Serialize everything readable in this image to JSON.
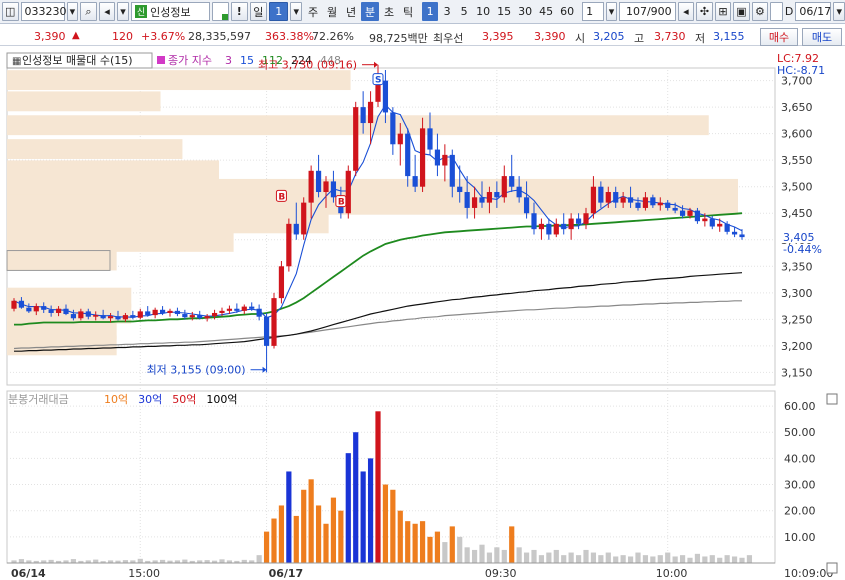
{
  "toolbar": {
    "code": "033230",
    "badge": "신",
    "stock_name": "인성정보",
    "exclaim": "!",
    "period_main": "일",
    "period_main_num": "1",
    "periods": [
      "주",
      "월",
      "년",
      "분",
      "초",
      "틱"
    ],
    "period_selected": "분",
    "intervals": [
      "1",
      "3",
      "5",
      "10",
      "15",
      "30",
      "45",
      "60"
    ],
    "interval_selected": "1",
    "interval_custom": "1",
    "count": "107/900",
    "checkbox_label": "D",
    "date": "06/17"
  },
  "quote": {
    "price": "3,390",
    "arrow": "▲",
    "change": "120",
    "change_pct": "+3.67%",
    "volume": "28,335,597",
    "vol_ratio": "363.38%",
    "turnover": "72.26%",
    "amount": "98,725백만",
    "best_label": "최우선",
    "ask": "3,395",
    "bid": "3,390",
    "open_label": "시",
    "open": "3,205",
    "high_label": "고",
    "high": "3,730",
    "low_label": "저",
    "low": "3,155",
    "buy_label": "매수",
    "sell_label": "매도"
  },
  "legend": {
    "title": "인성정보 매물대 수(15)",
    "ma_label": "종가 지수",
    "ma_values": [
      "3",
      "15",
      "112",
      "224",
      "448"
    ],
    "lc": "LC:7.92",
    "hc": "HC:-8.71"
  },
  "annotations": {
    "high": "최고 3,730 (09:16)",
    "low": "최저 3,155 (09:00)",
    "current_price": "3,405",
    "current_pct": "-0.44%"
  },
  "volume_legend": {
    "title": "분봉거래대금",
    "levels": [
      "10억",
      "30억",
      "50억",
      "100억"
    ]
  },
  "x_labels": [
    "06/14",
    "15:00",
    "06/17",
    "09:30",
    "10:00",
    "10:09:00"
  ],
  "colors": {
    "up": "#d0141c",
    "down": "#1a4fd6",
    "ma3": "#1a4fd6",
    "ma15": "#1e8a1e",
    "ma112": "#111111",
    "ma224": "#888888",
    "vol10": "#ee7d1e",
    "vol30": "#1a34d6",
    "vol50": "#d0141c",
    "vol100": "#000000",
    "vol_base": "#c8c8c8",
    "profile": "#f6e6d3"
  },
  "chart_data": {
    "type": "candlestick",
    "y_ticks": [
      3150,
      3200,
      3250,
      3300,
      3350,
      3400,
      3450,
      3500,
      3550,
      3600,
      3650,
      3700
    ],
    "ylim": [
      3130,
      3720
    ],
    "volume_ticks": [
      10,
      20,
      30,
      40,
      50,
      60
    ],
    "volume_ylim": [
      0,
      65
    ],
    "candles": [
      [
        3270,
        3290,
        3265,
        3285
      ],
      [
        3285,
        3292,
        3270,
        3272
      ],
      [
        3272,
        3280,
        3262,
        3265
      ],
      [
        3265,
        3280,
        3258,
        3275
      ],
      [
        3275,
        3282,
        3262,
        3268
      ],
      [
        3268,
        3276,
        3255,
        3262
      ],
      [
        3262,
        3275,
        3256,
        3270
      ],
      [
        3270,
        3278,
        3258,
        3260
      ],
      [
        3260,
        3268,
        3248,
        3252
      ],
      [
        3252,
        3270,
        3248,
        3265
      ],
      [
        3265,
        3270,
        3250,
        3255
      ],
      [
        3255,
        3265,
        3248,
        3258
      ],
      [
        3258,
        3268,
        3250,
        3252
      ],
      [
        3252,
        3262,
        3244,
        3256
      ],
      [
        3256,
        3266,
        3248,
        3250
      ],
      [
        3250,
        3262,
        3245,
        3258
      ],
      [
        3258,
        3266,
        3250,
        3253
      ],
      [
        3253,
        3270,
        3250,
        3265
      ],
      [
        3265,
        3275,
        3255,
        3258
      ],
      [
        3258,
        3272,
        3252,
        3268
      ],
      [
        3268,
        3275,
        3258,
        3262
      ],
      [
        3262,
        3270,
        3255,
        3266
      ],
      [
        3266,
        3272,
        3256,
        3260
      ],
      [
        3260,
        3268,
        3250,
        3254
      ],
      [
        3254,
        3264,
        3248,
        3258
      ],
      [
        3258,
        3266,
        3250,
        3252
      ],
      [
        3252,
        3260,
        3246,
        3256
      ],
      [
        3256,
        3268,
        3250,
        3262
      ],
      [
        3262,
        3272,
        3256,
        3266
      ],
      [
        3266,
        3276,
        3260,
        3270
      ],
      [
        3270,
        3280,
        3262,
        3266
      ],
      [
        3266,
        3278,
        3260,
        3274
      ],
      [
        3274,
        3282,
        3266,
        3270
      ],
      [
        3270,
        3278,
        3248,
        3255
      ],
      [
        3255,
        3262,
        3150,
        3200
      ],
      [
        3200,
        3300,
        3195,
        3290
      ],
      [
        3290,
        3360,
        3280,
        3350
      ],
      [
        3350,
        3440,
        3340,
        3430
      ],
      [
        3430,
        3470,
        3400,
        3410
      ],
      [
        3410,
        3480,
        3400,
        3470
      ],
      [
        3470,
        3540,
        3440,
        3530
      ],
      [
        3530,
        3560,
        3480,
        3490
      ],
      [
        3490,
        3520,
        3460,
        3510
      ],
      [
        3510,
        3530,
        3470,
        3480
      ],
      [
        3480,
        3500,
        3440,
        3450
      ],
      [
        3450,
        3540,
        3440,
        3530
      ],
      [
        3530,
        3660,
        3520,
        3650
      ],
      [
        3650,
        3680,
        3600,
        3620
      ],
      [
        3620,
        3680,
        3580,
        3660
      ],
      [
        3660,
        3730,
        3650,
        3700
      ],
      [
        3700,
        3720,
        3620,
        3640
      ],
      [
        3640,
        3650,
        3560,
        3580
      ],
      [
        3580,
        3620,
        3540,
        3600
      ],
      [
        3600,
        3610,
        3500,
        3520
      ],
      [
        3520,
        3560,
        3490,
        3500
      ],
      [
        3500,
        3630,
        3490,
        3610
      ],
      [
        3610,
        3640,
        3560,
        3570
      ],
      [
        3570,
        3600,
        3520,
        3540
      ],
      [
        3540,
        3580,
        3510,
        3560
      ],
      [
        3560,
        3570,
        3480,
        3500
      ],
      [
        3500,
        3540,
        3470,
        3490
      ],
      [
        3490,
        3520,
        3440,
        3460
      ],
      [
        3460,
        3500,
        3440,
        3480
      ],
      [
        3480,
        3510,
        3460,
        3470
      ],
      [
        3470,
        3500,
        3450,
        3490
      ],
      [
        3490,
        3510,
        3460,
        3480
      ],
      [
        3480,
        3540,
        3470,
        3520
      ],
      [
        3520,
        3560,
        3490,
        3500
      ],
      [
        3500,
        3520,
        3470,
        3480
      ],
      [
        3480,
        3510,
        3440,
        3450
      ],
      [
        3450,
        3470,
        3410,
        3420
      ],
      [
        3420,
        3440,
        3400,
        3430
      ],
      [
        3430,
        3440,
        3400,
        3410
      ],
      [
        3410,
        3440,
        3405,
        3430
      ],
      [
        3430,
        3450,
        3410,
        3420
      ],
      [
        3420,
        3450,
        3400,
        3440
      ],
      [
        3440,
        3450,
        3420,
        3430
      ],
      [
        3430,
        3460,
        3420,
        3450
      ],
      [
        3450,
        3520,
        3440,
        3500
      ],
      [
        3500,
        3510,
        3460,
        3470
      ],
      [
        3470,
        3500,
        3460,
        3490
      ],
      [
        3490,
        3500,
        3460,
        3470
      ],
      [
        3470,
        3490,
        3460,
        3480
      ],
      [
        3480,
        3500,
        3460,
        3470
      ],
      [
        3470,
        3480,
        3455,
        3460
      ],
      [
        3460,
        3490,
        3455,
        3480
      ],
      [
        3480,
        3485,
        3460,
        3465
      ],
      [
        3465,
        3480,
        3455,
        3470
      ],
      [
        3470,
        3475,
        3455,
        3460
      ],
      [
        3460,
        3470,
        3450,
        3455
      ],
      [
        3455,
        3465,
        3440,
        3445
      ],
      [
        3445,
        3460,
        3440,
        3455
      ],
      [
        3455,
        3460,
        3430,
        3435
      ],
      [
        3435,
        3450,
        3425,
        3440
      ],
      [
        3440,
        3445,
        3420,
        3425
      ],
      [
        3425,
        3440,
        3415,
        3430
      ],
      [
        3430,
        3435,
        3410,
        3415
      ],
      [
        3415,
        3425,
        3405,
        3410
      ],
      [
        3410,
        3420,
        3400,
        3405
      ]
    ],
    "volumes": [
      [
        1,
        0
      ],
      [
        1.5,
        0
      ],
      [
        1,
        0
      ],
      [
        0.8,
        0
      ],
      [
        1,
        0
      ],
      [
        1.2,
        0
      ],
      [
        0.8,
        0
      ],
      [
        1,
        0
      ],
      [
        1.5,
        0
      ],
      [
        0.8,
        0
      ],
      [
        1,
        0
      ],
      [
        1.3,
        0
      ],
      [
        0.7,
        0
      ],
      [
        1,
        0
      ],
      [
        0.9,
        0
      ],
      [
        1.1,
        0
      ],
      [
        1,
        0
      ],
      [
        1.6,
        0
      ],
      [
        0.8,
        0
      ],
      [
        1,
        0
      ],
      [
        1.2,
        0
      ],
      [
        0.9,
        0
      ],
      [
        1,
        0
      ],
      [
        1.3,
        0
      ],
      [
        0.8,
        0
      ],
      [
        1,
        0
      ],
      [
        1.1,
        0
      ],
      [
        0.9,
        0
      ],
      [
        1.4,
        0
      ],
      [
        1,
        0
      ],
      [
        0.8,
        0
      ],
      [
        1.2,
        0
      ],
      [
        1,
        0
      ],
      [
        3,
        0
      ],
      [
        12,
        1
      ],
      [
        17,
        1
      ],
      [
        22,
        1
      ],
      [
        35,
        2
      ],
      [
        18,
        1
      ],
      [
        28,
        1
      ],
      [
        32,
        1
      ],
      [
        22,
        1
      ],
      [
        15,
        1
      ],
      [
        25,
        1
      ],
      [
        20,
        1
      ],
      [
        42,
        2
      ],
      [
        50,
        2
      ],
      [
        35,
        2
      ],
      [
        40,
        2
      ],
      [
        58,
        3
      ],
      [
        30,
        1
      ],
      [
        28,
        1
      ],
      [
        20,
        1
      ],
      [
        16,
        1
      ],
      [
        15,
        1
      ],
      [
        16,
        1
      ],
      [
        10,
        1
      ],
      [
        12,
        1
      ],
      [
        8,
        0
      ],
      [
        14,
        1
      ],
      [
        10,
        0
      ],
      [
        6,
        0
      ],
      [
        5,
        0
      ],
      [
        7,
        0
      ],
      [
        4,
        0
      ],
      [
        6,
        0
      ],
      [
        5,
        0
      ],
      [
        14,
        1
      ],
      [
        6,
        0
      ],
      [
        4,
        0
      ],
      [
        5,
        0
      ],
      [
        3,
        0
      ],
      [
        4,
        0
      ],
      [
        5,
        0
      ],
      [
        3,
        0
      ],
      [
        4,
        0
      ],
      [
        3,
        0
      ],
      [
        5,
        0
      ],
      [
        4,
        0
      ],
      [
        3,
        0
      ],
      [
        4,
        0
      ],
      [
        2.5,
        0
      ],
      [
        3,
        0
      ],
      [
        2.5,
        0
      ],
      [
        4,
        0
      ],
      [
        3,
        0
      ],
      [
        2.5,
        0
      ],
      [
        3,
        0
      ],
      [
        4,
        0
      ],
      [
        2.5,
        0
      ],
      [
        3,
        0
      ],
      [
        2,
        0
      ],
      [
        3.5,
        0
      ],
      [
        2.5,
        0
      ],
      [
        3,
        0
      ],
      [
        2,
        0
      ],
      [
        3,
        0
      ],
      [
        2.5,
        0
      ],
      [
        2,
        0
      ],
      [
        3,
        0
      ]
    ],
    "ma15": [
      3240,
      3240,
      3242,
      3243,
      3244,
      3244,
      3244,
      3244,
      3244,
      3245,
      3245,
      3245,
      3245,
      3245,
      3246,
      3246,
      3246,
      3247,
      3248,
      3248,
      3249,
      3250,
      3250,
      3251,
      3252,
      3252,
      3253,
      3254,
      3255,
      3256,
      3258,
      3259,
      3260,
      3260,
      3262,
      3265,
      3270,
      3275,
      3282,
      3290,
      3300,
      3310,
      3320,
      3330,
      3340,
      3350,
      3360,
      3370,
      3378,
      3385,
      3392,
      3396,
      3400,
      3403,
      3405,
      3408,
      3410,
      3412,
      3414,
      3415,
      3416,
      3417,
      3418,
      3419,
      3420,
      3421,
      3422,
      3423,
      3424,
      3425,
      3425,
      3426,
      3426,
      3427,
      3427,
      3428,
      3428,
      3429,
      3430,
      3431,
      3432,
      3433,
      3434,
      3435,
      3436,
      3437,
      3438,
      3439,
      3440,
      3441,
      3442,
      3443,
      3444,
      3445,
      3446,
      3447,
      3448,
      3449,
      3450
    ],
    "ma112": [
      3190,
      3190,
      3191,
      3191,
      3192,
      3192,
      3193,
      3193,
      3194,
      3194,
      3195,
      3195,
      3196,
      3196,
      3197,
      3197,
      3198,
      3198,
      3199,
      3199,
      3200,
      3200,
      3201,
      3201,
      3202,
      3202,
      3203,
      3204,
      3205,
      3206,
      3207,
      3208,
      3210,
      3212,
      3214,
      3216,
      3218,
      3220,
      3222,
      3225,
      3228,
      3232,
      3236,
      3240,
      3244,
      3248,
      3252,
      3256,
      3260,
      3263,
      3266,
      3269,
      3272,
      3275,
      3277,
      3279,
      3281,
      3283,
      3285,
      3287,
      3288,
      3290,
      3292,
      3293,
      3295,
      3296,
      3298,
      3299,
      3301,
      3302,
      3304,
      3305,
      3306,
      3308,
      3309,
      3310,
      3312,
      3313,
      3314,
      3316,
      3317,
      3318,
      3320,
      3321,
      3322,
      3323,
      3325,
      3326,
      3327,
      3328,
      3329,
      3331,
      3332,
      3333,
      3334,
      3335,
      3336,
      3337,
      3338
    ],
    "ma224": [
      3195,
      3196,
      3196,
      3197,
      3197,
      3198,
      3198,
      3199,
      3199,
      3200,
      3200,
      3201,
      3201,
      3202,
      3202,
      3203,
      3203,
      3204,
      3204,
      3205,
      3205,
      3206,
      3206,
      3207,
      3207,
      3208,
      3209,
      3210,
      3211,
      3212,
      3213,
      3214,
      3215,
      3216,
      3217,
      3218,
      3219,
      3220,
      3222,
      3224,
      3226,
      3228,
      3230,
      3232,
      3234,
      3236,
      3238,
      3240,
      3242,
      3244,
      3245,
      3247,
      3248,
      3250,
      3251,
      3253,
      3254,
      3255,
      3257,
      3258,
      3259,
      3260,
      3261,
      3262,
      3263,
      3264,
      3265,
      3266,
      3267,
      3268,
      3268,
      3269,
      3270,
      3271,
      3271,
      3272,
      3273,
      3273,
      3274,
      3275,
      3275,
      3276,
      3277,
      3277,
      3278,
      3279,
      3279,
      3280,
      3280,
      3281,
      3281,
      3282,
      3282,
      3283,
      3283,
      3284,
      3284,
      3285,
      3285
    ],
    "profile": [
      {
        "price": 3700,
        "len": 0.47
      },
      {
        "price": 3660,
        "len": 0.21
      },
      {
        "price": 3615,
        "len": 0.96
      },
      {
        "price": 3570,
        "len": 0.24
      },
      {
        "price": 3530,
        "len": 0.29
      },
      {
        "price": 3495,
        "len": 1.0
      },
      {
        "price": 3465,
        "len": 1.0
      },
      {
        "price": 3430,
        "len": 0.44
      },
      {
        "price": 3395,
        "len": 0.31
      },
      {
        "price": 3360,
        "len": 0.15
      },
      {
        "price": 3290,
        "len": 0.17
      },
      {
        "price": 3260,
        "len": 0.17
      },
      {
        "price": 3230,
        "len": 0.15
      },
      {
        "price": 3200,
        "len": 0.15
      }
    ],
    "signals": [
      {
        "index": 36,
        "label": "B",
        "price": 3480
      },
      {
        "index": 44,
        "label": "B",
        "price": 3470
      },
      {
        "index": 49,
        "label": "S",
        "price": 3700
      }
    ]
  }
}
